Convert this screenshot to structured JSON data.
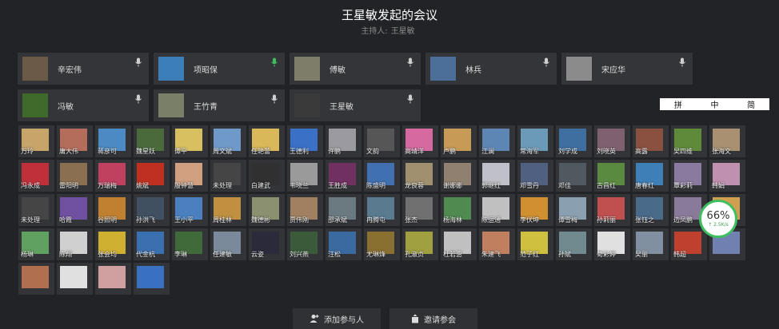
{
  "meeting": {
    "title": "王星敏发起的会议",
    "host_label": "主持人:",
    "host_name": "王星敏"
  },
  "speakers": [
    {
      "name": "辛宏伟",
      "color": "#6b5a48"
    },
    {
      "name": "项昭保",
      "color": "#3c7fb8",
      "active": true
    },
    {
      "name": "傅敏",
      "color": "#7d7d6a"
    },
    {
      "name": "林兵",
      "color": "#4c6f9a"
    },
    {
      "name": "宋应华",
      "color": "#8b8b8b"
    },
    {
      "name": "冯敏",
      "color": "#3f6a2c"
    },
    {
      "name": "王竹青",
      "color": "#7a8068"
    },
    {
      "name": "王星敏",
      "color": "#3a3a3a"
    }
  ],
  "ime": {
    "items": [
      "拼",
      "中",
      "简"
    ]
  },
  "participants": [
    {
      "name": "万玲",
      "c": "#c7a56a"
    },
    {
      "name": "庸大伟",
      "c": "#b46d5a"
    },
    {
      "name": "蒋彦可",
      "c": "#4b8ac2"
    },
    {
      "name": "魏星跃",
      "c": "#4a6a3c"
    },
    {
      "name": "谭平",
      "c": "#d8c060"
    },
    {
      "name": "周文斌",
      "c": "#6f99c8"
    },
    {
      "name": "任艳蕾",
      "c": "#d9b85a"
    },
    {
      "name": "王德利",
      "c": "#3b70c7"
    },
    {
      "name": "许鹏",
      "c": "#9a9aa0"
    },
    {
      "name": "文韵",
      "c": "#565656"
    },
    {
      "name": "高靖洋",
      "c": "#d66aa0"
    },
    {
      "name": "卢鹏",
      "c": "#c79a55"
    },
    {
      "name": "江澜",
      "c": "#5e86b4"
    },
    {
      "name": "常海军",
      "c": "#6b9ab8"
    },
    {
      "name": "刘学成",
      "c": "#3f6ea0"
    },
    {
      "name": "刘晓英",
      "c": "#7f6070"
    },
    {
      "name": "高露",
      "c": "#8a5040"
    },
    {
      "name": "吴四维",
      "c": "#5f8a3a"
    },
    {
      "name": "张海文",
      "c": "#a89070"
    },
    {
      "name": "冯永成",
      "c": "#c0303a"
    },
    {
      "name": "雷阳明",
      "c": "#8a7050"
    },
    {
      "name": "万瑞梅",
      "c": "#c04060"
    },
    {
      "name": "姚斌",
      "c": "#c03020"
    },
    {
      "name": "殷钟慧",
      "c": "#d0a080"
    },
    {
      "name": "未处理",
      "c": "#454545"
    },
    {
      "name": "白建武",
      "c": "#303030"
    },
    {
      "name": "韦晓兰",
      "c": "#9a9a9a"
    },
    {
      "name": "王胜成",
      "c": "#703060"
    },
    {
      "name": "陈盛明",
      "c": "#4070b0"
    },
    {
      "name": "龙良蓉",
      "c": "#a09070"
    },
    {
      "name": "谢娜娜",
      "c": "#908070"
    },
    {
      "name": "郭继红",
      "c": "#c0c0c8"
    },
    {
      "name": "邓雪丹",
      "c": "#506080"
    },
    {
      "name": "邓佳",
      "c": "#505860"
    },
    {
      "name": "古昌红",
      "c": "#5a8a40"
    },
    {
      "name": "唐春红",
      "c": "#3f7fb8"
    },
    {
      "name": "覃彩莉",
      "c": "#8a7aa0"
    },
    {
      "name": "韩娟",
      "c": "#c090b0"
    },
    {
      "name": "未处理",
      "c": "#454545"
    },
    {
      "name": "哈霞",
      "c": "#7050a0"
    },
    {
      "name": "谷照明",
      "c": "#c08030"
    },
    {
      "name": "孙洪飞",
      "c": "#405060"
    },
    {
      "name": "王小平",
      "c": "#4a80c0"
    },
    {
      "name": "周桂林",
      "c": "#c09040"
    },
    {
      "name": "魏德彬",
      "c": "#8a9070"
    },
    {
      "name": "贾伟刚",
      "c": "#a08060"
    },
    {
      "name": "邵承斌",
      "c": "#6a7a80"
    },
    {
      "name": "冉腾屯",
      "c": "#5a7a90"
    },
    {
      "name": "张杰",
      "c": "#707070"
    },
    {
      "name": "杨海林",
      "c": "#508a50"
    },
    {
      "name": "陈运通",
      "c": "#c0c0c0"
    },
    {
      "name": "李伏坤",
      "c": "#d09030"
    },
    {
      "name": "谭雪梅",
      "c": "#8aa0b0"
    },
    {
      "name": "孙莉丽",
      "c": "#c05050"
    },
    {
      "name": "张钰之",
      "c": "#4a6a8a"
    },
    {
      "name": "边凤鹏",
      "c": "#8a7a9a"
    },
    {
      "name": "李明丹",
      "c": "#d0a050"
    },
    {
      "name": "杨琳",
      "c": "#60a060"
    },
    {
      "name": "陈翔",
      "c": "#d0d0d0"
    },
    {
      "name": "张会均",
      "c": "#d0b030"
    },
    {
      "name": "代金杭",
      "c": "#3a70b0"
    },
    {
      "name": "李琳",
      "c": "#406a3a"
    },
    {
      "name": "任建敏",
      "c": "#7a8a9a"
    },
    {
      "name": "云姿",
      "c": "#2a2a3a"
    },
    {
      "name": "刘兴燕",
      "c": "#3a5a3a"
    },
    {
      "name": "汪松",
      "c": "#3a6aa0"
    },
    {
      "name": "尤琳烽",
      "c": "#8a7030"
    },
    {
      "name": "孔淑贞",
      "c": "#a0a040"
    },
    {
      "name": "杜若惠",
      "c": "#c0c0c0"
    },
    {
      "name": "朱建飞",
      "c": "#c08060"
    },
    {
      "name": "范子红",
      "c": "#d0c040"
    },
    {
      "name": "孙斌",
      "c": "#708a90"
    },
    {
      "name": "荀彩婷",
      "c": "#e0e0e0"
    },
    {
      "name": "吴丽",
      "c": "#8090a0"
    },
    {
      "name": "韩超",
      "c": "#c04030"
    },
    {
      "name": "",
      "c": "#7080b0"
    },
    {
      "name": "",
      "c": "#b07050"
    },
    {
      "name": "",
      "c": "#e0e0e0"
    },
    {
      "name": "",
      "c": "#d0a0a0"
    },
    {
      "name": "",
      "c": "#3a70c0"
    }
  ],
  "network": {
    "percent": "66%",
    "rate": "↑ 2.5K/s"
  },
  "actions": {
    "add_label": "添加参与人",
    "invite_label": "邀请参会"
  }
}
